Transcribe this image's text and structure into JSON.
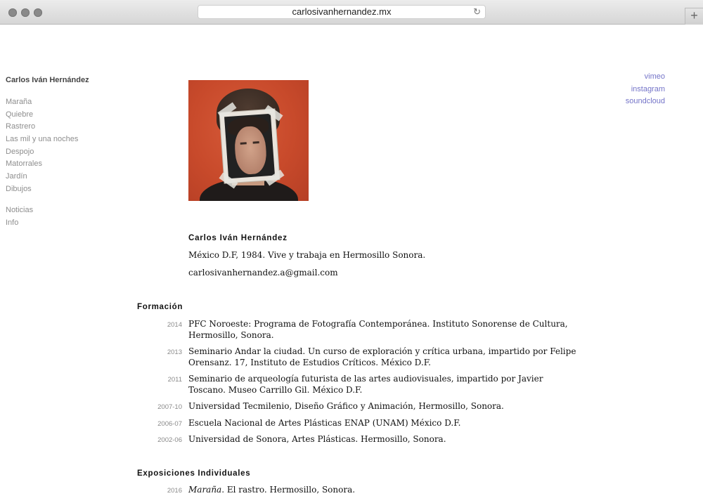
{
  "browser": {
    "url": "carlosivanhernandez.mx",
    "reload_icon": "↻",
    "new_tab_label": "+"
  },
  "sidebar": {
    "site_name": "Carlos Iván Hernández",
    "projects": [
      "Maraña",
      "Quiebre",
      "Rastrero",
      "Las mil y una noches",
      "Despojo",
      "Matorrales",
      "Jardín",
      "Dibujos"
    ],
    "secondary": [
      "Noticias",
      "Info"
    ]
  },
  "social_links": [
    "vimeo",
    "instagram",
    "soundcloud"
  ],
  "intro": {
    "name": "Carlos Iván Hernández",
    "bio": "México D.F, 1984. Vive y trabaja en Hermosillo Sonora.",
    "email": "carlosivanhernandez.a@gmail.com"
  },
  "formacion": {
    "title": "Formación",
    "entries": [
      {
        "year": "2014",
        "text": "PFC Noroeste: Programa de Fotografía Contemporánea. Instituto Sonorense de Cultura, Hermosillo, Sonora."
      },
      {
        "year": "2013",
        "text": "Seminario Andar la ciudad. Un curso de exploración y crítica urbana, impartido por Felipe Orensanz. 17, Instituto de Estudios Críticos. México D.F."
      },
      {
        "year": "2011",
        "text": "Seminario de arqueología futurista de las artes audiovisuales, impartido por Javier Toscano. Museo Carrillo Gil. México D.F."
      },
      {
        "year": "2007-10",
        "text": "Universidad Tecmilenio, Diseño Gráfico y Animación, Hermosillo, Sonora."
      },
      {
        "year": "2006-07",
        "text": "Escuela Nacional de Artes Plásticas ENAP (UNAM) México D.F."
      },
      {
        "year": "2002-06",
        "text": "Universidad de Sonora, Artes Plásticas. Hermosillo, Sonora."
      }
    ]
  },
  "exposiciones": {
    "title": "Exposiciones Individuales",
    "entries": [
      {
        "year": "2016",
        "title": "Maraña",
        "text": ". El rastro. Hermosillo, Sonora."
      }
    ]
  }
}
